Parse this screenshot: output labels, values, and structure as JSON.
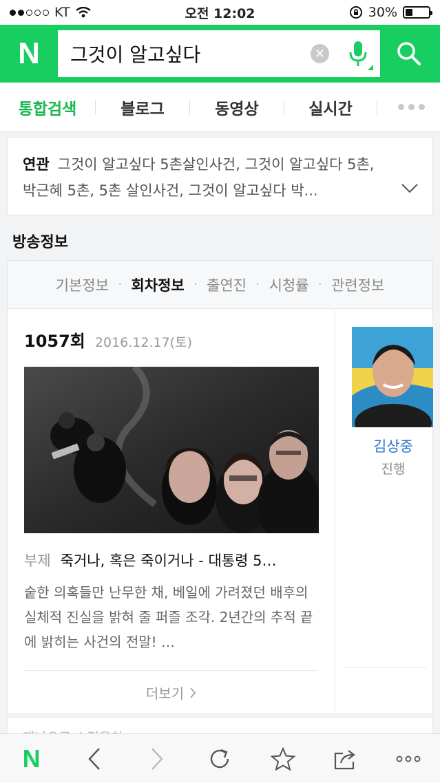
{
  "status_bar": {
    "carrier": "KT",
    "time": "오전 12:02",
    "battery_pct": 30,
    "battery_text": "30%"
  },
  "search": {
    "query": "그것이 알고싶다",
    "logo": "N",
    "icons": [
      "clear-icon",
      "microphone-icon",
      "search-icon"
    ]
  },
  "tabs": [
    {
      "label": "통합검색",
      "active": true
    },
    {
      "label": "블로그"
    },
    {
      "label": "동영상"
    },
    {
      "label": "실시간"
    }
  ],
  "related": {
    "label": "연관",
    "text": "그것이 알고싶다 5촌살인사건, 그것이 알고싶다 5촌, 박근혜 5촌, 5촌 살인사건, 그것이 알고싶다 박..."
  },
  "broadcast": {
    "section_title": "방송정보",
    "subtabs": [
      {
        "label": "기본정보"
      },
      {
        "label": "회차정보",
        "active": true
      },
      {
        "label": "출연진"
      },
      {
        "label": "시청률"
      },
      {
        "label": "관련정보"
      }
    ],
    "episode": {
      "number": "1057회",
      "date": "2016.12.17(토)",
      "subtitle_label": "부제",
      "subtitle": "죽거나, 혹은 죽이거나 - 대통령 5…",
      "description": "숱한 의혹들만 난무한 채, 베일에 가려졌던 배후의 실체적 진실을 밝혀 줄 퍼즐 조각. 2년간의 추적 끝에 밝히는 사건의 전말! …",
      "more_label": "더보기"
    },
    "cast": {
      "name": "김상중",
      "role": "진행"
    },
    "next_section_peek": "재난으로 소진은하"
  },
  "toolbar": {
    "home_label": "N",
    "icons": [
      "back-icon",
      "forward-icon",
      "refresh-icon",
      "bookmark-star-icon",
      "share-icon",
      "more-icon"
    ]
  },
  "colors": {
    "brand_green": "#19ce60",
    "link_blue": "#2a73c9"
  }
}
